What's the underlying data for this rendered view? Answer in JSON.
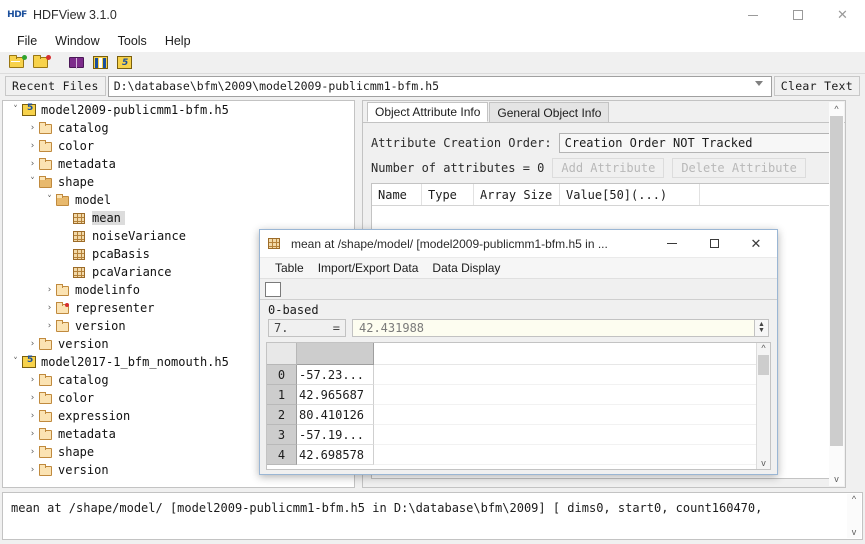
{
  "window": {
    "title": "HDFView 3.1.0",
    "app_icon": "hdf-icon",
    "controls": {
      "minimize": "–",
      "maximize": "□",
      "close": "✕"
    }
  },
  "menubar": {
    "items": [
      "File",
      "Window",
      "Tools",
      "Help"
    ]
  },
  "toolbar": {
    "icons": [
      "open-file-icon",
      "close-file-icon",
      "open-book-icon",
      "image-view-icon",
      "palette-view-icon"
    ]
  },
  "recent": {
    "button_label": "Recent Files",
    "path": "D:\\database\\bfm\\2009\\model2009-publicmm1-bfm.h5",
    "clear_label": "Clear Text"
  },
  "tree": {
    "nodes": [
      {
        "indent": 0,
        "twist": "v",
        "icon": "h5-file-icon",
        "label": "model2009-publicmm1-bfm.h5",
        "selected": false
      },
      {
        "indent": 1,
        "twist": ">",
        "icon": "folder-icon",
        "label": "catalog",
        "selected": false
      },
      {
        "indent": 1,
        "twist": ">",
        "icon": "folder-icon",
        "label": "color",
        "selected": false
      },
      {
        "indent": 1,
        "twist": ">",
        "icon": "folder-icon",
        "label": "metadata",
        "selected": false
      },
      {
        "indent": 1,
        "twist": "v",
        "icon": "folder-open-icon",
        "label": "shape",
        "selected": false
      },
      {
        "indent": 2,
        "twist": "v",
        "icon": "folder-open-icon",
        "label": "model",
        "selected": false
      },
      {
        "indent": 3,
        "twist": "",
        "icon": "dataset-icon",
        "label": "mean",
        "selected": true
      },
      {
        "indent": 3,
        "twist": "",
        "icon": "dataset-icon",
        "label": "noiseVariance",
        "selected": false
      },
      {
        "indent": 3,
        "twist": "",
        "icon": "dataset-icon",
        "label": "pcaBasis",
        "selected": false
      },
      {
        "indent": 3,
        "twist": "",
        "icon": "dataset-icon",
        "label": "pcaVariance",
        "selected": false
      },
      {
        "indent": 2,
        "twist": ">",
        "icon": "folder-icon",
        "label": "modelinfo",
        "selected": false
      },
      {
        "indent": 2,
        "twist": ">",
        "icon": "folder-alert-icon",
        "label": "representer",
        "selected": false
      },
      {
        "indent": 2,
        "twist": ">",
        "icon": "folder-icon",
        "label": "version",
        "selected": false
      },
      {
        "indent": 1,
        "twist": ">",
        "icon": "folder-icon",
        "label": "version",
        "selected": false
      },
      {
        "indent": 0,
        "twist": "v",
        "icon": "h5-file-icon",
        "label": "model2017-1_bfm_nomouth.h5",
        "selected": false
      },
      {
        "indent": 1,
        "twist": ">",
        "icon": "folder-icon",
        "label": "catalog",
        "selected": false
      },
      {
        "indent": 1,
        "twist": ">",
        "icon": "folder-icon",
        "label": "color",
        "selected": false
      },
      {
        "indent": 1,
        "twist": ">",
        "icon": "folder-icon",
        "label": "expression",
        "selected": false
      },
      {
        "indent": 1,
        "twist": ">",
        "icon": "folder-icon",
        "label": "metadata",
        "selected": false
      },
      {
        "indent": 1,
        "twist": ">",
        "icon": "folder-icon",
        "label": "shape",
        "selected": false
      },
      {
        "indent": 1,
        "twist": ">",
        "icon": "folder-icon",
        "label": "version",
        "selected": false
      }
    ]
  },
  "info": {
    "tabs": [
      {
        "label": "Object Attribute Info",
        "active": true
      },
      {
        "label": "General Object Info",
        "active": false
      }
    ],
    "creation_order_label": "Attribute Creation Order:",
    "creation_order_value": "Creation Order NOT Tracked",
    "num_attributes": "Number of attributes = 0",
    "add_attribute_label": "Add Attribute",
    "delete_attribute_label": "Delete Attribute",
    "table_headers": [
      "Name",
      "Type",
      "Array Size",
      "Value[50](...)"
    ]
  },
  "dialog": {
    "icon": "dataset-icon",
    "title": "mean  at /shape/model/  [model2009-publicmm1-bfm.h5  in ...",
    "controls": {
      "minimize": "–",
      "maximize": "□",
      "close": "✕"
    },
    "menu": [
      "Table",
      "Import/Export Data",
      "Data Display"
    ],
    "toolbar_icons": [
      "chart-icon"
    ],
    "based_label": "0-based",
    "cell_index": "7.",
    "cell_equals": "=",
    "cell_value": "42.431988",
    "grid": {
      "column_header": "",
      "rows": [
        {
          "index": "0",
          "value": "-57.23..."
        },
        {
          "index": "1",
          "value": "42.965687"
        },
        {
          "index": "2",
          "value": "80.410126"
        },
        {
          "index": "3",
          "value": "-57.19..."
        },
        {
          "index": "4",
          "value": "42.698578"
        }
      ]
    }
  },
  "status": {
    "text": "mean  at  /shape/model/  [model2009-publicmm1-bfm.h5  in  D:\\database\\bfm\\2009] [ dims0,  start0,  count160470,"
  },
  "colors": {
    "accent": "#1b4f9c",
    "folder": "#fbe3b3",
    "selection": "#dcdcdc",
    "dialog_border": "#9ab6d4"
  }
}
